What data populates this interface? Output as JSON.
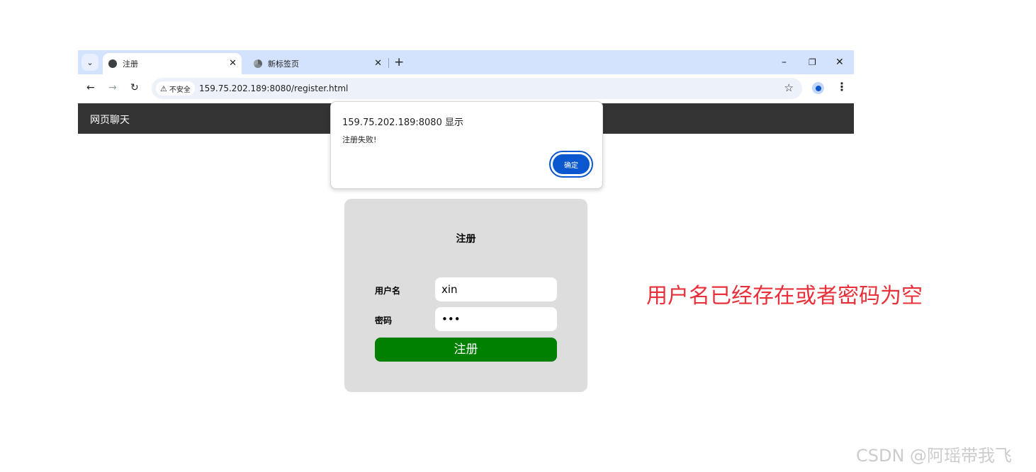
{
  "browser": {
    "tabs": [
      {
        "label": "注册",
        "active": true,
        "icon": "globe-icon"
      },
      {
        "label": "新标签页",
        "active": false,
        "icon": "chrome-icon"
      }
    ],
    "new_tab_symbol": "+",
    "tab_close_symbol": "✕",
    "window_controls": {
      "minimize": "–",
      "restore": "❐",
      "close": "✕"
    },
    "address": {
      "security_label": "不安全",
      "url": "159.75.202.189:8080/register.html"
    }
  },
  "site": {
    "brand": "网页聊天"
  },
  "dialog": {
    "title": "159.75.202.189:8080 显示",
    "message": "注册失败!",
    "ok_label": "确定"
  },
  "register_form": {
    "title": "注册",
    "username_label": "用户名",
    "username_value": "xin",
    "password_label": "密码",
    "password_value": "•••",
    "submit_label": "注册"
  },
  "annotation": "用户名已经存在或者密码为空",
  "watermark": "CSDN @阿瑶带我飞",
  "colors": {
    "tabstrip": "#d3e3fd",
    "navbar": "#333333",
    "dialog_button": "#0b57d0",
    "submit_button": "#008000",
    "annotation": "#e8303a",
    "card": "#dddddd"
  }
}
